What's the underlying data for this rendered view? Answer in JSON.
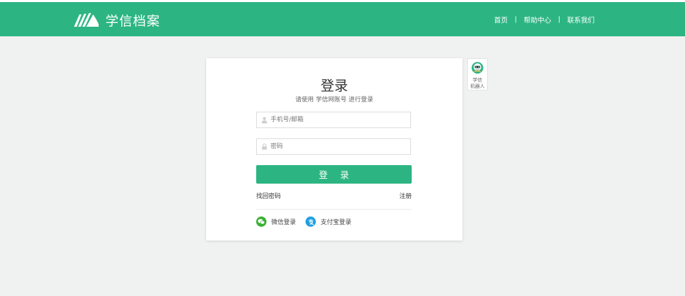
{
  "header": {
    "logo_text": "学信档案",
    "nav": {
      "home": "首页",
      "help": "帮助中心",
      "contact": "联系我们",
      "separator": "|"
    }
  },
  "login": {
    "title": "登录",
    "subtitle": "请使用 学信网账号 进行登录",
    "phone_placeholder": "手机号/邮箱",
    "password_placeholder": "密码",
    "submit_label": "登 录",
    "forgot_label": "找回密码",
    "register_label": "注册",
    "wechat_label": "微信登录",
    "alipay_label": "支付宝登录"
  },
  "robot": {
    "line1": "学信",
    "line2": "机器人"
  },
  "colors": {
    "brand": "#2cb583",
    "wechat": "#3cb035",
    "alipay": "#1f9fe0"
  },
  "icons": {
    "logo": "book-pages-icon",
    "phone_field": "user-icon",
    "password_field": "lock-icon",
    "wechat": "wechat-icon",
    "alipay": "alipay-icon",
    "robot": "robot-avatar-icon"
  }
}
